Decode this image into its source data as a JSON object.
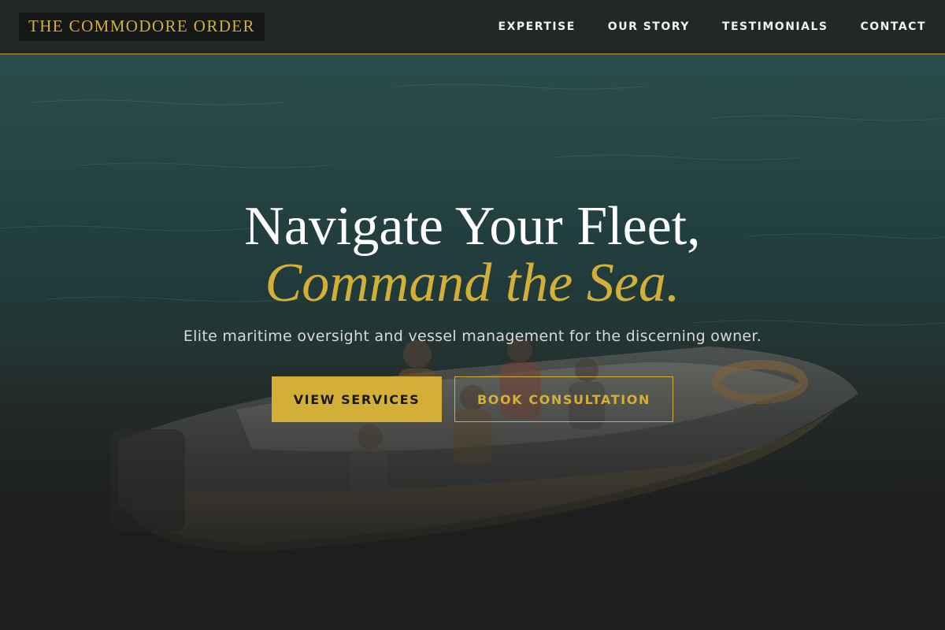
{
  "header": {
    "logo_text": "THE COMMODORE ORDER",
    "nav": [
      {
        "label": "EXPERTISE"
      },
      {
        "label": "OUR STORY"
      },
      {
        "label": "TESTIMONIALS"
      },
      {
        "label": "CONTACT"
      }
    ]
  },
  "hero": {
    "headline_line1": "Navigate Your Fleet,",
    "headline_line2": "Command the Sea.",
    "subtitle": "Elite maritime oversight and vessel management for the discerning owner.",
    "primary_button": "VIEW SERVICES",
    "secondary_button": "BOOK CONSULTATION"
  },
  "colors": {
    "accent_gold": "#d4af37",
    "header_bg": "#222424",
    "ocean": "#2a5152"
  }
}
